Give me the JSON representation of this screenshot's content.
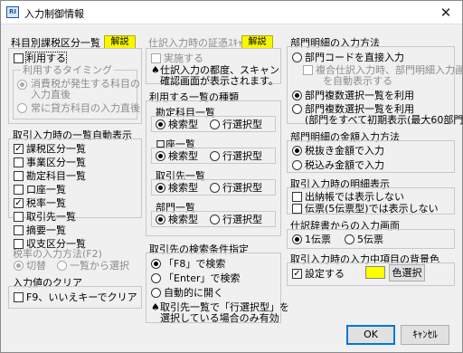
{
  "window": {
    "title": "入力制御情報",
    "app_icon": "RI"
  },
  "colors": {
    "help_button": "#ffff00",
    "highlight_swatch": "#ffff00"
  },
  "sec1": {
    "title": "科目別課税区分一覧",
    "help": "解説",
    "use_label": "利用する",
    "use_checked": false,
    "timing_title": "利用するタイミング",
    "timing_opt1": "消費税が発生する科目の",
    "timing_opt1b": "入力直後",
    "timing_opt2": "常に貸方科目の入力直後"
  },
  "sec2": {
    "title": "仕訳入力時の証憑ｽｷｬﾝ",
    "help": "解説",
    "impl_label": "実施する",
    "note1": "仕訳入力の都度、スキャン",
    "note2": "確認画面が表示されます。"
  },
  "sec3": {
    "title": "部門明細の入力方法",
    "opt1": "部門コードを直接入力",
    "opt1_sub1": "複合仕訳入力時、部門明細入力画面",
    "opt1_sub2": "を自動表示する",
    "opt2": "部門複数選択一覧を利用",
    "opt3": "部門複数選択一覧を利用",
    "opt3_sub": "(部門をすべて初期表示(最大60部門))"
  },
  "sec4": {
    "title": "取引入力時の一覧自動表示",
    "items": [
      {
        "label": "課税区分一覧",
        "checked": true
      },
      {
        "label": "事業区分一覧",
        "checked": false
      },
      {
        "label": "勘定科目一覧",
        "checked": false
      },
      {
        "label": "口座一覧",
        "checked": false
      },
      {
        "label": "税率一覧",
        "checked": true
      },
      {
        "label": "取引先一覧",
        "checked": false
      },
      {
        "label": "摘要一覧",
        "checked": false
      },
      {
        "label": "収支区分一覧",
        "checked": false
      }
    ]
  },
  "sec5": {
    "title": "利用する一覧の種類",
    "groups": [
      {
        "title": "勘定科目一覧",
        "opt1": "検索型",
        "opt2": "行選択型",
        "selected": 1
      },
      {
        "title": "口座一覧",
        "opt1": "検索型",
        "opt2": "行選択型",
        "selected": 1
      },
      {
        "title": "取引先一覧",
        "opt1": "検索型",
        "opt2": "行選択型",
        "selected": 1
      },
      {
        "title": "部門一覧",
        "opt1": "検索型",
        "opt2": "行選択型",
        "selected": 1
      }
    ]
  },
  "sec6": {
    "title": "部門明細の金額入力方法",
    "opt1": "税抜き金額で入力",
    "opt2": "税込み金額で入力"
  },
  "sec7": {
    "title": "取引入力時の明細表示",
    "opt1": "出納帳では表示しない",
    "opt2": "伝票(5伝票型)では表示しない"
  },
  "sec8": {
    "title": "仕訳辞書からの入力画面",
    "opt1": "1伝票",
    "opt2": "5伝票"
  },
  "sec9": {
    "title": "税率の入力方法(F2)",
    "opt1": "切替",
    "opt2": "一覧から選択"
  },
  "sec10": {
    "title": "入力値のクリア",
    "opt1": "F9、いいえキーでクリア"
  },
  "sec11": {
    "title": "取引先の検索条件指定",
    "opt1": "「F8」で検索",
    "opt2": "「Enter」で検索",
    "opt3": "自動的に開く",
    "note1": "取引先一覧で「行選択型」を",
    "note2": "選択している場合のみ有効"
  },
  "sec12": {
    "title": "取引入力時の入力中項目の背景色",
    "opt1": "設定する",
    "color_btn": "色選択"
  },
  "buttons": {
    "ok": "OK",
    "cancel": "ｷｬﾝｾﾙ"
  }
}
